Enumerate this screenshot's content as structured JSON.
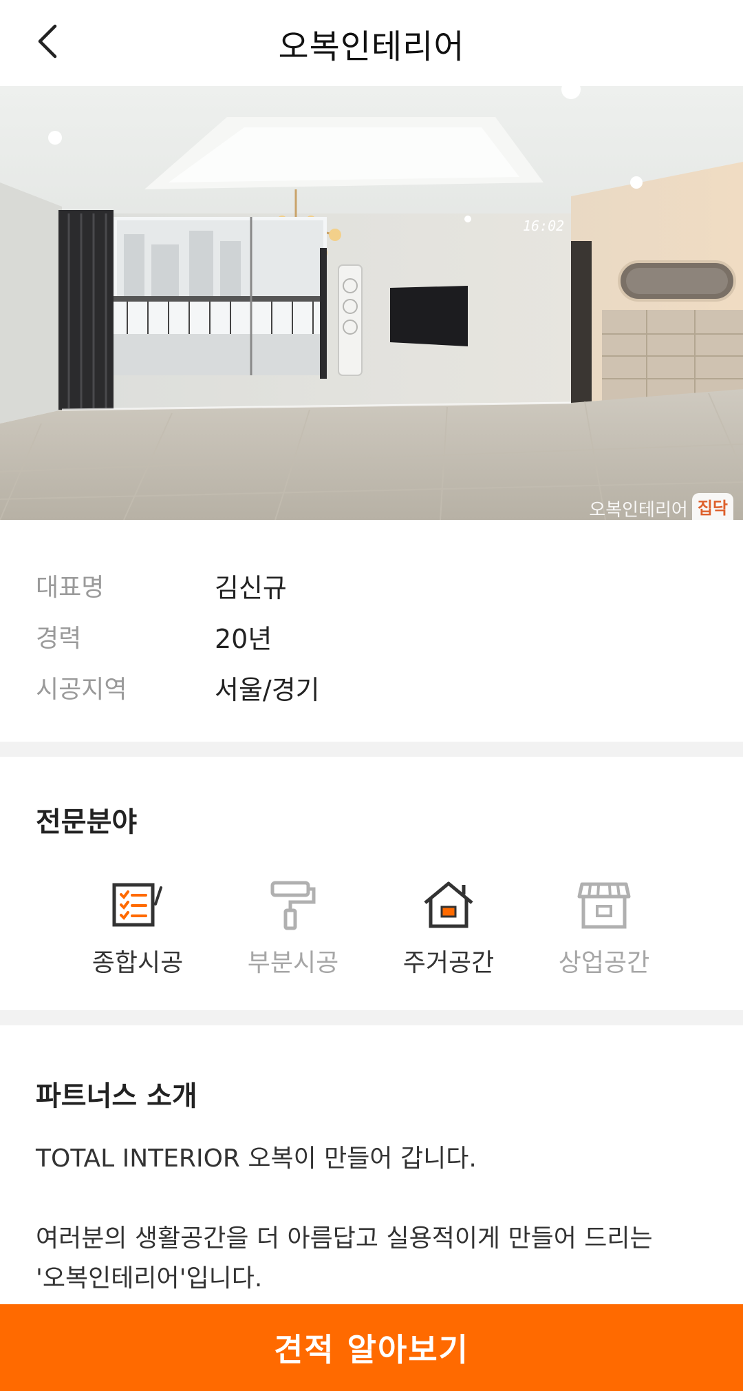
{
  "header": {
    "title": "오복인테리어",
    "back_icon": "chevron-left-icon"
  },
  "hero": {
    "clock_text": "16:02",
    "watermark_text": "오복인테리어",
    "watermark_badge": "집닥"
  },
  "info": {
    "rows": [
      {
        "label": "대표명",
        "value": "김신규"
      },
      {
        "label": "경력",
        "value": "20년"
      },
      {
        "label": "시공지역",
        "value": "서울/경기"
      }
    ]
  },
  "specialties": {
    "title": "전문분야",
    "items": [
      {
        "label": "종합시공",
        "icon": "checklist-icon",
        "active": true
      },
      {
        "label": "부분시공",
        "icon": "paint-roller-icon",
        "active": false
      },
      {
        "label": "주거공간",
        "icon": "house-icon",
        "active": true
      },
      {
        "label": "상업공간",
        "icon": "storefront-icon",
        "active": false
      }
    ]
  },
  "intro": {
    "title": "파트너스 소개",
    "text": "TOTAL INTERIOR 오복이 만들어 갑니다.\n\n여러분의 생활공간을 더 아름답고 실용적이게 만들어 드리는\n'오복인테리어'입니다."
  },
  "cta": {
    "label": "견적 알아보기"
  },
  "colors": {
    "accent": "#ff6a00",
    "icon_active": "#333333",
    "icon_active_fill": "#ff6a00",
    "icon_inactive": "#b0b0b0",
    "label_muted": "#9a9a9a",
    "divider": "#f2f2f2"
  }
}
